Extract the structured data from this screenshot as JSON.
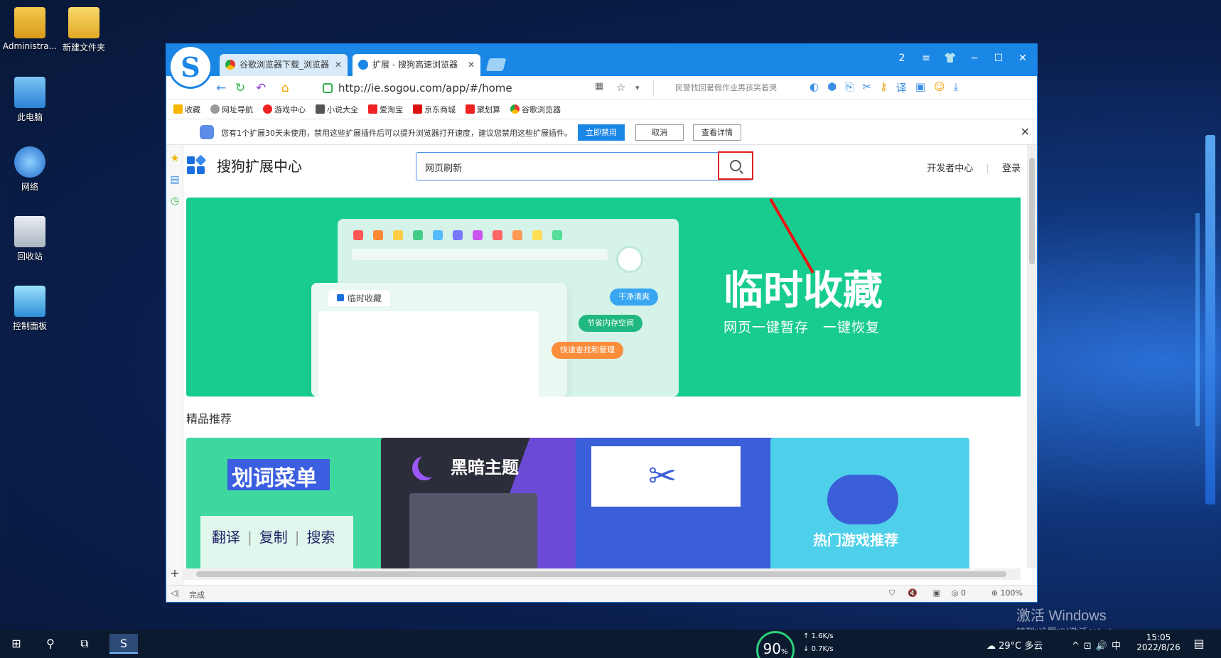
{
  "desktop": {
    "icons": [
      {
        "label": "Administra..."
      },
      {
        "label": "新建文件夹"
      },
      {
        "label": "此电脑"
      },
      {
        "label": "网络"
      },
      {
        "label": "回收站"
      },
      {
        "label": "控制面板"
      }
    ],
    "watermark_title": "激活 Windows",
    "watermark_sub": "转到\"设置\"以激活 Windows。"
  },
  "browser": {
    "tabs": [
      {
        "label": "谷歌浏览器下载_浏览器"
      },
      {
        "label": "扩展 - 搜狗高速浏览器"
      }
    ],
    "window_controls": [
      "2",
      "≡",
      "👕",
      "−",
      "☐",
      "✕"
    ],
    "url": "http://ie.sogou.com/app/#/home",
    "search_hint": "民警找回暑假作业男孩笑着哭",
    "bookmarks": [
      "收藏",
      "网址导航",
      "游戏中心",
      "小说大全",
      "爱淘宝",
      "京东商城",
      "聚划算",
      "谷歌浏览器"
    ],
    "notice": {
      "text": "您有1个扩展30天未使用，禁用这些扩展插件后可以提升浏览器打开速度，建议您禁用这些扩展插件。",
      "btn_disable": "立即禁用",
      "btn_cancel": "取消",
      "btn_details": "查看详情"
    },
    "status_text": "完成",
    "status_zoom": "100%",
    "status_count": "0"
  },
  "page": {
    "brand": "搜狗扩展中心",
    "search_value": "网页刷新",
    "dev_center": "开发者中心",
    "login": "登录",
    "banner": {
      "title": "临时收藏",
      "subtitle": "网页一键暂存　一键恢复",
      "inner_tab": "临时收藏",
      "pill1": "干净清爽",
      "pill2": "节省内存空间",
      "pill3": "快速查找和管理"
    },
    "section_title": "精品推荐",
    "cards": [
      {
        "title": "划词菜单",
        "sub1": "翻译",
        "sub2": "复制",
        "sub3": "搜索"
      },
      {
        "title": "黑暗主题"
      },
      {
        "title": ""
      },
      {
        "title": "热门游戏推荐"
      }
    ]
  },
  "taskbar": {
    "cpu": "90",
    "net_up": "1.6K/s",
    "net_down": "0.7K/s",
    "weather": "29°C 多云",
    "ime": "中",
    "time": "15:05",
    "date": "2022/8/26"
  },
  "colors": {
    "accent": "#1a86e5",
    "banner": "#18cc8f",
    "highlight": "#e02020"
  }
}
